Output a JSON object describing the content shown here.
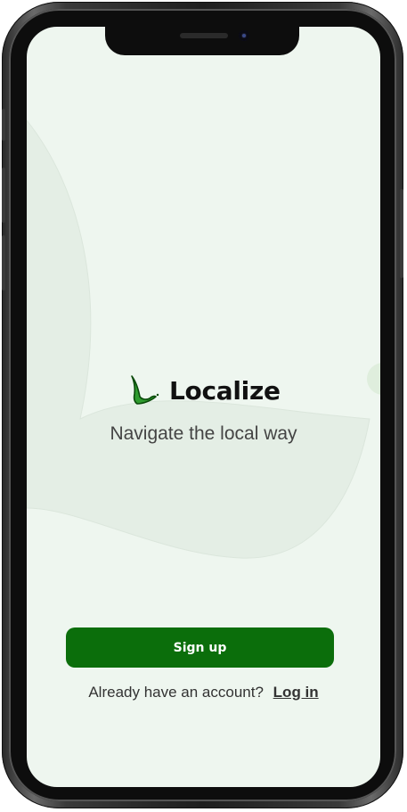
{
  "app": {
    "name": "Localize",
    "tagline": "Navigate the local way"
  },
  "actions": {
    "signup_label": "Sign up",
    "login_prompt": "Already have an account?",
    "login_label": "Log in"
  },
  "colors": {
    "screen_bg": "#eef6ef",
    "primary": "#0b6e0b",
    "logo_green": "#2e9b2e",
    "text_dark": "#111111"
  },
  "icons": {
    "logo": "leaf-l-logo-icon"
  }
}
